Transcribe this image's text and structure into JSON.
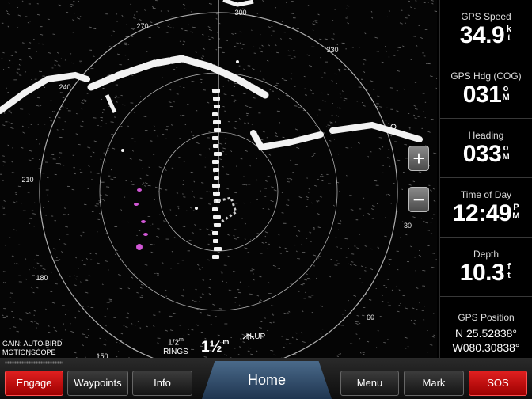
{
  "radar": {
    "bearing_labels": [
      "300",
      "270",
      "330",
      "240",
      "210",
      "180",
      "150",
      "60",
      "30"
    ],
    "gain_line1": "GAIN: AUTO BIRD",
    "gain_line2": "MOTIONSCOPE",
    "rings_value": "1/2",
    "rings_unit": "m",
    "rings_label": "RINGS",
    "range_value": "1½",
    "range_unit": "m",
    "orientation": "H-UP",
    "zoom_in_symbol": "+",
    "zoom_out_symbol": "−",
    "echo_color": "#f2f2f2",
    "motionscope_color": "#d257d6",
    "ring_color": "#d8d8d8"
  },
  "sidebar": {
    "fields": [
      {
        "label": "GPS Speed",
        "value": "34.9",
        "unit_top": "k",
        "unit_bottom": "t"
      },
      {
        "label": "GPS Hdg (COG)",
        "value": "031",
        "unit_top": "o",
        "unit_bottom": "M"
      },
      {
        "label": "Heading",
        "value": "033",
        "unit_top": "o",
        "unit_bottom": "M"
      },
      {
        "label": "Time of Day",
        "value": "12:49",
        "unit_top": "P",
        "unit_bottom": "M"
      },
      {
        "label": "Depth",
        "value": "10.3",
        "unit_top": "f",
        "unit_bottom": "t"
      }
    ],
    "position": {
      "label": "GPS Position",
      "lat": "N  25.52838°",
      "lon": "W080.30838°"
    }
  },
  "toolbar": {
    "engage": "Engage",
    "waypoints": "Waypoints",
    "info": "Info",
    "home": "Home",
    "menu": "Menu",
    "mark": "Mark",
    "sos": "SOS",
    "alert_color": "#d40000",
    "home_color": "#35557a"
  }
}
